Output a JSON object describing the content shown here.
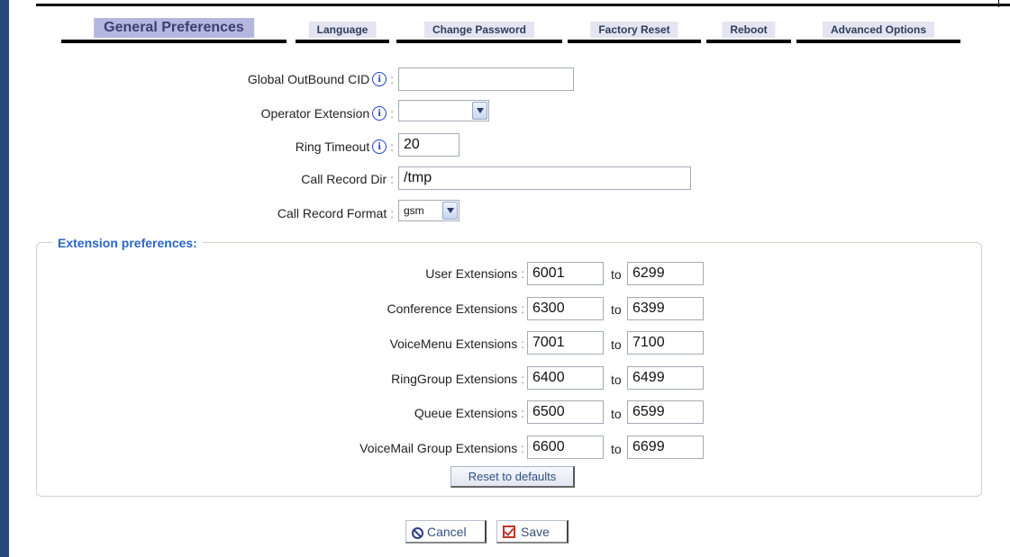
{
  "tabs": [
    {
      "label": "General Preferences",
      "active": true
    },
    {
      "label": "Language"
    },
    {
      "label": "Change Password"
    },
    {
      "label": "Factory Reset"
    },
    {
      "label": "Reboot"
    },
    {
      "label": "Advanced Options"
    }
  ],
  "general": {
    "global_outbound_cid": {
      "label": "Global OutBound CID",
      "value": ""
    },
    "operator_extension": {
      "label": "Operator Extension",
      "value": ""
    },
    "ring_timeout": {
      "label": "Ring Timeout",
      "value": "20"
    },
    "call_record_dir": {
      "label": "Call Record Dir",
      "value": "/tmp"
    },
    "call_record_format": {
      "label": "Call Record Format",
      "value": "gsm"
    }
  },
  "extension_prefs": {
    "legend": "Extension preferences:",
    "to_label": "to",
    "rows": [
      {
        "label": "User Extensions",
        "from": "6001",
        "to": "6299"
      },
      {
        "label": "Conference Extensions",
        "from": "6300",
        "to": "6399"
      },
      {
        "label": "VoiceMenu Extensions",
        "from": "7001",
        "to": "7100"
      },
      {
        "label": "RingGroup Extensions",
        "from": "6400",
        "to": "6499"
      },
      {
        "label": "Queue Extensions",
        "from": "6500",
        "to": "6599"
      },
      {
        "label": "VoiceMail Group Extensions",
        "from": "6600",
        "to": "6699"
      }
    ],
    "reset_label": "Reset to defaults"
  },
  "actions": {
    "cancel_label": "Cancel",
    "save_label": "Save"
  },
  "colors": {
    "tab_active": "#b5b6e0",
    "tab_inactive": "#e4e4f2",
    "legend": "#2a66c9",
    "sidebar": "#27487a",
    "info_icon": "#1f3fd0"
  }
}
